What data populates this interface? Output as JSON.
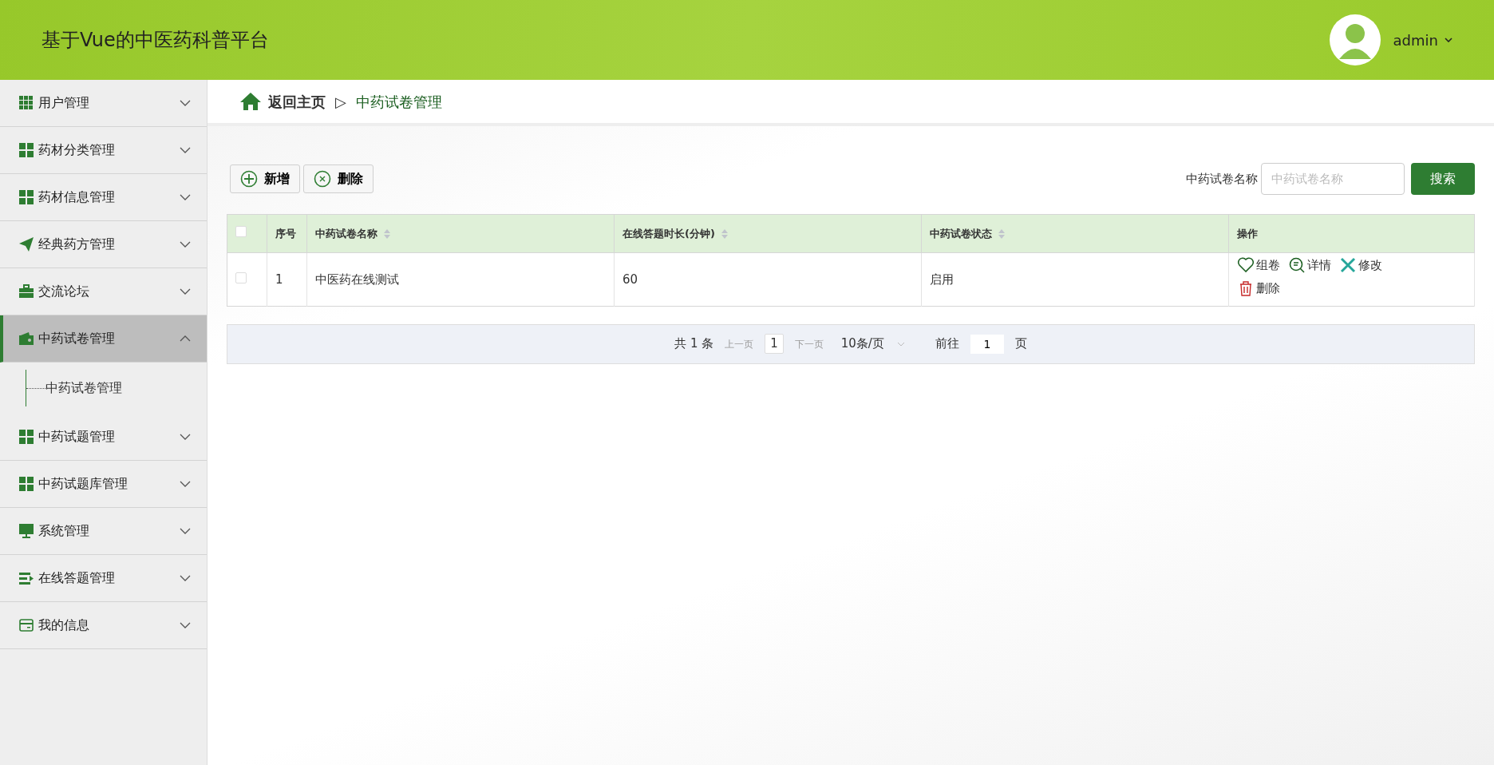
{
  "header": {
    "title": "基于Vue的中医药科普平台",
    "user": {
      "name": "admin"
    }
  },
  "sidebar": {
    "items": [
      {
        "label": "用户管理",
        "kind": "grid9",
        "expanded": false,
        "selected": false
      },
      {
        "label": "药材分类管理",
        "kind": "grid4",
        "expanded": false,
        "selected": false
      },
      {
        "label": "药材信息管理",
        "kind": "grid4",
        "expanded": false,
        "selected": false
      },
      {
        "label": "经典药方管理",
        "kind": "plane",
        "expanded": false,
        "selected": false
      },
      {
        "label": "交流论坛",
        "kind": "briefcase",
        "expanded": false,
        "selected": false
      },
      {
        "label": "中药试卷管理",
        "kind": "wallet",
        "expanded": true,
        "selected": true,
        "children": [
          {
            "label": "中药试卷管理"
          }
        ]
      },
      {
        "label": "中药试题管理",
        "kind": "grid4",
        "expanded": false,
        "selected": false
      },
      {
        "label": "中药试题库管理",
        "kind": "grid4",
        "expanded": false,
        "selected": false
      },
      {
        "label": "系统管理",
        "kind": "monitor",
        "expanded": false,
        "selected": false
      },
      {
        "label": "在线答题管理",
        "kind": "list",
        "expanded": false,
        "selected": false
      },
      {
        "label": "我的信息",
        "kind": "card",
        "expanded": false,
        "selected": false
      }
    ]
  },
  "breadcrumb": {
    "home": "返回主页",
    "separator": "▷",
    "current": "中药试卷管理"
  },
  "toolbar": {
    "buttons": [
      {
        "label": "新增",
        "kind": "add"
      },
      {
        "label": "删除",
        "kind": "delete"
      }
    ],
    "search": {
      "label": "中药试卷名称",
      "placeholder": "中药试卷名称",
      "button": "搜索"
    }
  },
  "table": {
    "select_all_checked": false,
    "columns": [
      {
        "label": "序号",
        "sortable": false
      },
      {
        "label": "中药试卷名称",
        "sortable": true
      },
      {
        "label": "在线答题时长(分钟)",
        "sortable": true
      },
      {
        "label": "中药试卷状态",
        "sortable": true
      },
      {
        "label": "操作",
        "sortable": false
      }
    ],
    "rows": [
      {
        "checked": false,
        "cells": [
          "1",
          "中医药在线测试",
          "60",
          "启用"
        ],
        "actions": [
          {
            "label": "组卷",
            "kind": "compose"
          },
          {
            "label": "详情",
            "kind": "detail"
          },
          {
            "label": "修改",
            "kind": "edit"
          },
          {
            "label": "删除",
            "kind": "delete"
          }
        ]
      }
    ]
  },
  "pagination": {
    "total": "共 1 条",
    "prev": "上一页",
    "page": "1",
    "next": "下一页",
    "page_size": "10条/页",
    "goto_prefix": "前往",
    "goto_value": "1",
    "goto_suffix": "页"
  }
}
